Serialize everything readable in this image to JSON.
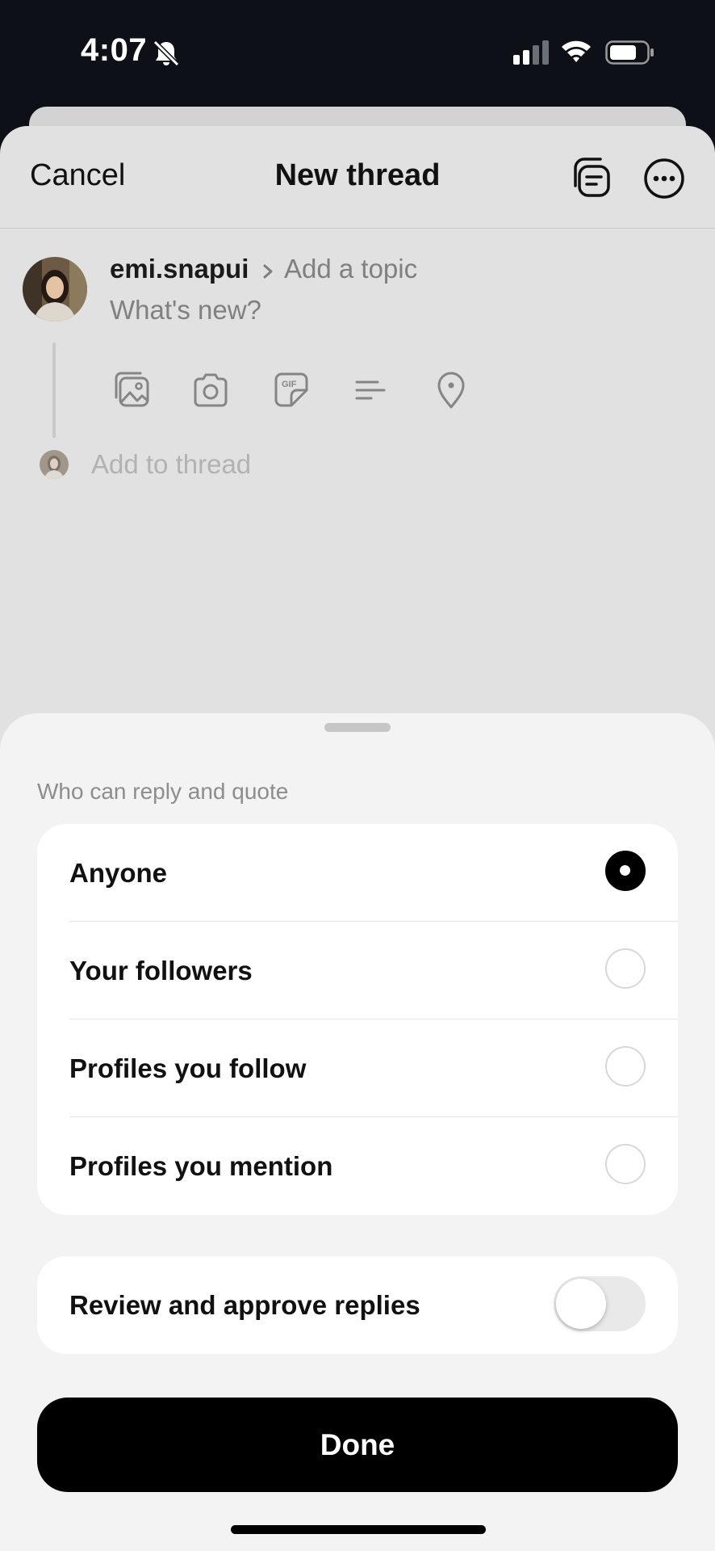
{
  "status_bar": {
    "time": "4:07",
    "icons": [
      "bell-slash-icon",
      "signal-icon",
      "wifi-icon",
      "battery-icon"
    ]
  },
  "composer": {
    "cancel_label": "Cancel",
    "title": "New thread",
    "header_icons": [
      "drafts-icon",
      "more-icon"
    ],
    "username": "emi.snapui",
    "topic_placeholder": "Add a topic",
    "body_placeholder": "What's new?",
    "toolbar_icons": [
      "gallery-icon",
      "camera-icon",
      "gif-icon",
      "poll-icon",
      "location-icon"
    ],
    "add_to_thread": "Add to thread"
  },
  "reply_sheet": {
    "section_label": "Who can reply and quote",
    "options": [
      {
        "label": "Anyone",
        "selected": true
      },
      {
        "label": "Your followers",
        "selected": false
      },
      {
        "label": "Profiles you follow",
        "selected": false
      },
      {
        "label": "Profiles you mention",
        "selected": false
      }
    ],
    "approve_label": "Review and approve replies",
    "approve_enabled": false,
    "done_label": "Done"
  },
  "colors": {
    "background": "#0d1117",
    "composer": "#e1e1e1",
    "sheet": "#f3f3f3",
    "accent": "#000000"
  }
}
